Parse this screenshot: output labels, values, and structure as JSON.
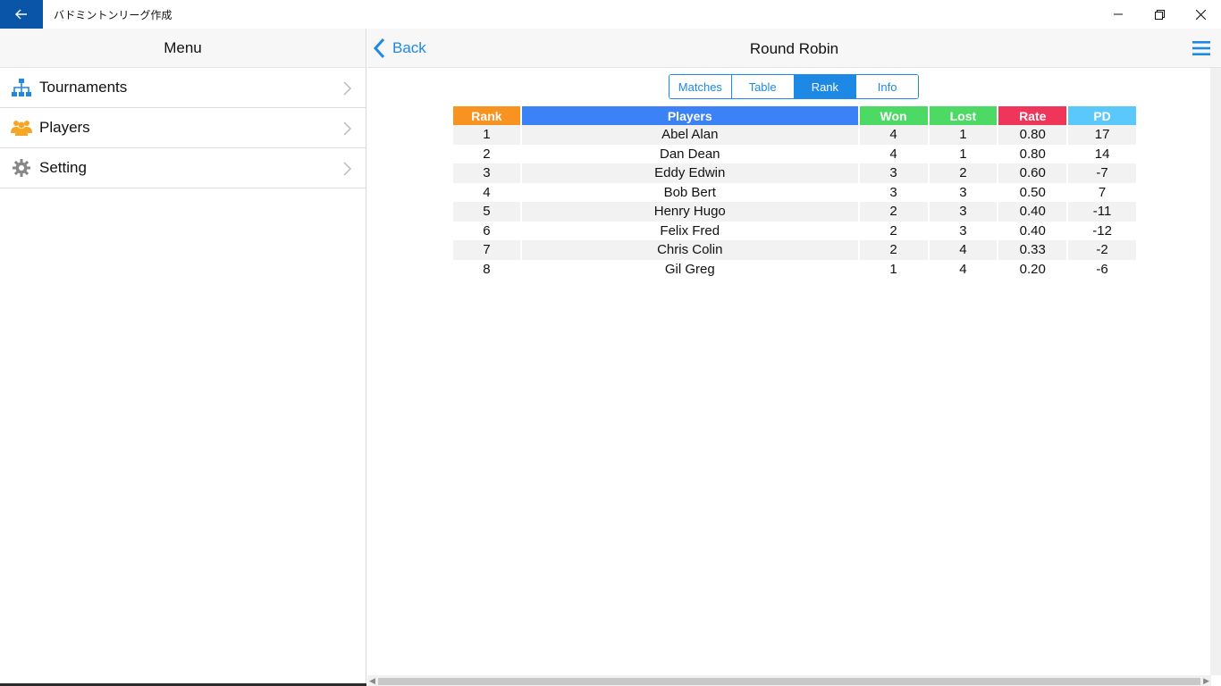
{
  "window": {
    "title": "バドミントンリーグ作成",
    "back_icon": "arrow-left-icon",
    "controls": [
      "minimize-icon",
      "restore-icon",
      "close-icon"
    ]
  },
  "sidebar": {
    "header": "Menu",
    "items": [
      {
        "label": "Tournaments",
        "icon": "tournament-tree-icon",
        "color": "#1e88e5"
      },
      {
        "label": "Players",
        "icon": "people-icon",
        "color": "#f5a623"
      },
      {
        "label": "Setting",
        "icon": "gear-icon",
        "color": "#888888"
      }
    ]
  },
  "header": {
    "back_label": "Back",
    "title": "Round Robin",
    "menu_icon": "hamburger-icon"
  },
  "tabs": [
    {
      "label": "Matches",
      "active": false
    },
    {
      "label": "Table",
      "active": false
    },
    {
      "label": "Rank",
      "active": true
    },
    {
      "label": "Info",
      "active": false
    }
  ],
  "table": {
    "columns": [
      {
        "label": "Rank",
        "color": "#f7931e"
      },
      {
        "label": "Players",
        "color": "#3b82f6"
      },
      {
        "label": "Won",
        "color": "#4cd964"
      },
      {
        "label": "Lost",
        "color": "#4cd964"
      },
      {
        "label": "Rate",
        "color": "#f0355a"
      },
      {
        "label": "PD",
        "color": "#5ac8fa"
      }
    ],
    "rows": [
      [
        "1",
        "Abel Alan",
        "4",
        "1",
        "0.80",
        "17"
      ],
      [
        "2",
        "Dan Dean",
        "4",
        "1",
        "0.80",
        "14"
      ],
      [
        "3",
        "Eddy Edwin",
        "3",
        "2",
        "0.60",
        "-7"
      ],
      [
        "4",
        "Bob Bert",
        "3",
        "3",
        "0.50",
        "7"
      ],
      [
        "5",
        "Henry Hugo",
        "2",
        "3",
        "0.40",
        "-11"
      ],
      [
        "6",
        "Felix Fred",
        "2",
        "3",
        "0.40",
        "-12"
      ],
      [
        "7",
        "Chris Colin",
        "2",
        "4",
        "0.33",
        "-2"
      ],
      [
        "8",
        "Gil Greg",
        "1",
        "4",
        "0.20",
        "-6"
      ]
    ]
  }
}
